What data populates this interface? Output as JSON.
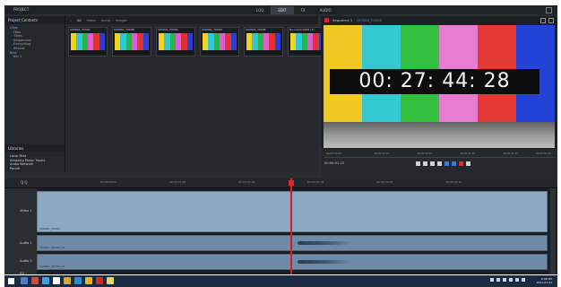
{
  "topbar": {
    "project": "PROJECT",
    "tabs": [
      "LOG",
      "EDIT",
      "FX",
      "AUDIO"
    ],
    "active_tab": "EDIT"
  },
  "left": {
    "title": "Project Contents",
    "items": [
      {
        "label": "Clips",
        "selected": true
      },
      {
        "label": "Files",
        "sub": true
      },
      {
        "label": "Titles",
        "sub": true
      },
      {
        "label": "Sequences",
        "sub": true
      },
      {
        "label": "Everything",
        "sub": true
      },
      {
        "label": "Recent",
        "sub": true
      },
      {
        "label": "Bins",
        "selected": true
      },
      {
        "label": "Bin 1",
        "sub": true
      }
    ],
    "libraries_title": "Libraries",
    "libraries": [
      "Local Files",
      "Amazing Music Tracks",
      "Audio Network",
      "Pond5"
    ]
  },
  "browser": {
    "tabs": [
      "All",
      "Video",
      "Audio",
      "Images"
    ],
    "active_tab": "All",
    "thumbs": [
      "00000A_T000A",
      "00000A_T000B",
      "00000A_T000C",
      "00000A_T000D",
      "00000A_T000E",
      "No-name 0000 (1)"
    ]
  },
  "viewer": {
    "title": "Sequence 1",
    "subtitle": "00000A_T000A",
    "timecode": "00: 27: 44: 28",
    "small_timecode": "00:00:01:15",
    "ruler_ticks": [
      "00:00:00:00",
      "00:00:00:10",
      "00:00:00:20",
      "00:00:01:05",
      "00:00:01:15",
      "00:00:01:20"
    ]
  },
  "timeline": {
    "zoom_label": "Q Q",
    "ticks": [
      "00:00:00:00",
      "00:00:01:00",
      "00:00:01:10",
      "00:00:01:20",
      "00:00:02:05",
      "00:00:02:15"
    ],
    "tracks": [
      {
        "name": "Video 1",
        "clip": "00000A_T000A"
      },
      {
        "name": "Audio 1",
        "clip": "00000A_T000A_A1"
      },
      {
        "name": "Audio 2",
        "clip": "00000A_T000A_A2"
      },
      {
        "name": "A3",
        "clip": ""
      }
    ]
  },
  "taskbar": {
    "time": "8:08 PM",
    "date": "2021-07-21"
  }
}
